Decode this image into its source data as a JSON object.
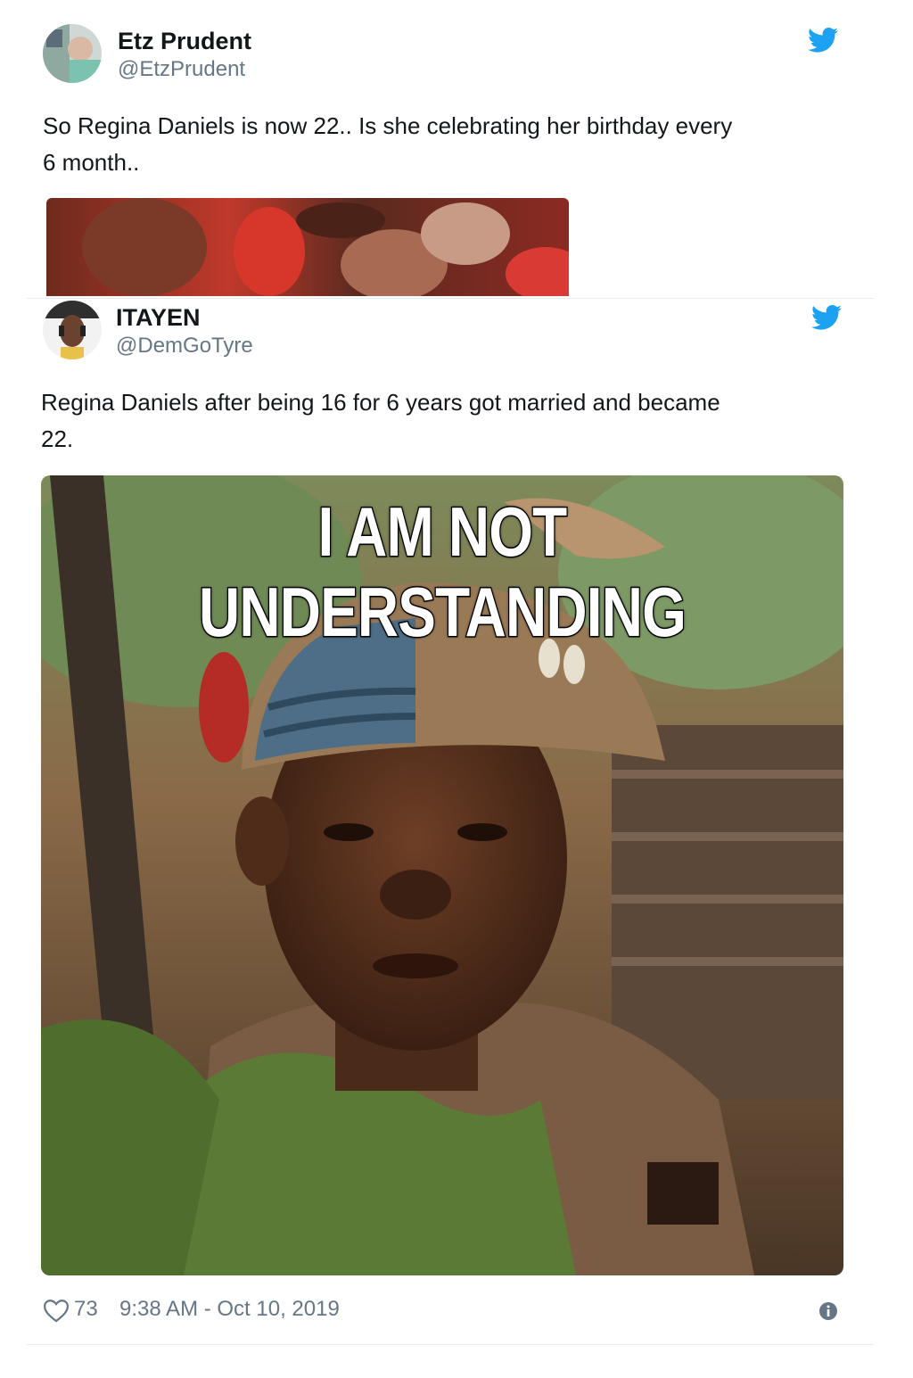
{
  "tweet1": {
    "name": "Etz Prudent",
    "handle": "@EtzPrudent",
    "text_line1": "So Regina Daniels is now 22.. Is she celebrating her birthday every",
    "text_line2": "6 month..",
    "icon": "twitter-bird-icon"
  },
  "tweet2": {
    "name": "ITAYEN",
    "handle": "@DemGoTyre",
    "text_line1": "Regina Daniels after being 16 for 6 years got married and became",
    "text_line2": "22.",
    "icon": "twitter-bird-icon",
    "meme": {
      "line1": "I AM NOT",
      "line2": "UNDERSTANDING"
    },
    "likes": "73",
    "timestamp": "9:38 AM - Oct 10, 2019"
  },
  "colors": {
    "twitter_blue": "#1da1f2",
    "text": "#14171a",
    "secondary": "#657786",
    "divider": "#e6ecf0"
  }
}
